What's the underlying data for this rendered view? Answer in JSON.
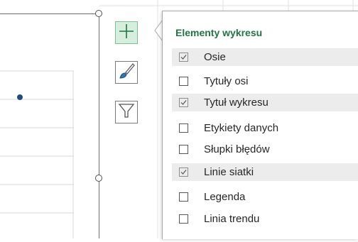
{
  "panel": {
    "title": "Elementy wykresu",
    "items": [
      {
        "label": "Osie",
        "checked": true
      },
      {
        "label": "Tytuły osi",
        "checked": false
      },
      {
        "label": "Tytuł wykresu",
        "checked": true
      },
      {
        "label": "Etykiety danych",
        "checked": false
      },
      {
        "label": "Słupki błędów",
        "checked": false
      },
      {
        "label": "Linie siatki",
        "checked": true
      },
      {
        "label": "Legenda",
        "checked": false
      },
      {
        "label": "Linia trendu",
        "checked": false
      }
    ]
  },
  "buttons": {
    "elements": {
      "icon": "plus-icon",
      "active": true
    },
    "styles": {
      "icon": "paintbrush-icon"
    },
    "filters": {
      "icon": "funnel-icon"
    }
  },
  "colors": {
    "accent_green": "#217346",
    "active_button_bg": "#d6eedd",
    "data_point": "#1f4e79",
    "gridline": "#e2e2e2"
  }
}
